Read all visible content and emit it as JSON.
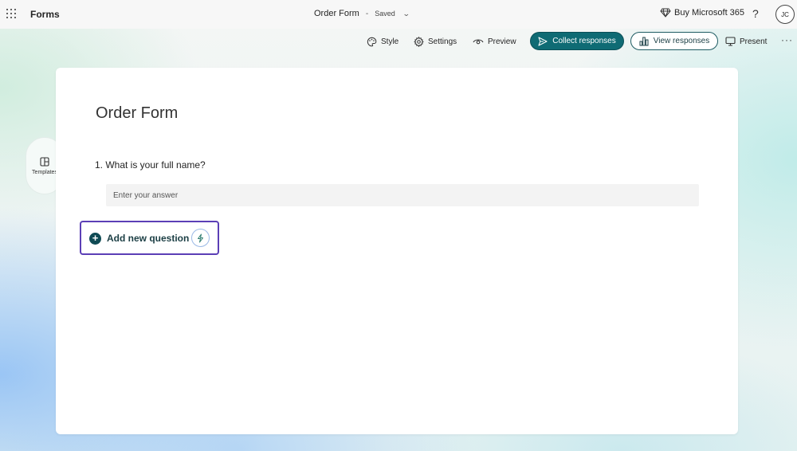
{
  "topbar": {
    "app_name": "Forms",
    "doc_title": "Order Form",
    "separator": "-",
    "status": "Saved",
    "buy_label": "Buy Microsoft 365",
    "help_label": "?",
    "avatar_initials": "JC"
  },
  "commands": {
    "style": "Style",
    "settings": "Settings",
    "preview": "Preview",
    "collect": "Collect responses",
    "view": "View responses",
    "present": "Present",
    "more": "···"
  },
  "rail": {
    "templates_label": "Templates"
  },
  "form": {
    "title": "Order Form",
    "questions": [
      {
        "label": "1. What is your full name?",
        "placeholder": "Enter your answer"
      }
    ],
    "add_question_label": "Add new question"
  },
  "colors": {
    "primary": "#0f6b74",
    "add_question_border": "#5b3fb6",
    "plus_fill": "#0f4a54"
  }
}
